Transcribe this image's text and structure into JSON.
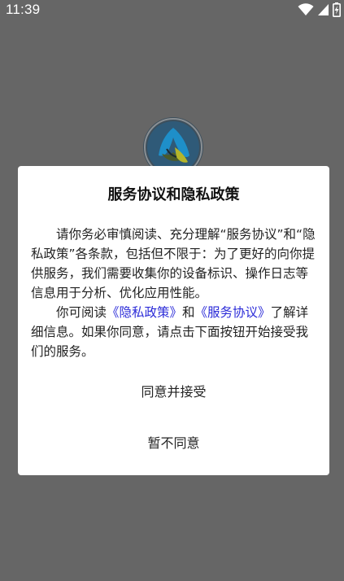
{
  "status_bar": {
    "time": "11:39",
    "icons": [
      "wifi-icon",
      "cell-signal-icon",
      "battery-charging-icon"
    ]
  },
  "app_logo": {
    "icon": "app-logo-icon"
  },
  "dialog": {
    "title": "服务协议和隐私政策",
    "paragraph1": "请你务必审慎阅读、充分理解“服务协议”和“隐私政策”各条款，包括但不限于：为了更好的向你提供服务，我们需要收集你的设备标识、操作日志等信息用于分析、优化应用性能。",
    "paragraph2_prefix": "你可阅读",
    "privacy_link": "《隐私政策》",
    "and_text": "和",
    "agreement_link": "《服务协议》",
    "paragraph2_suffix": "了解详细信息。如果你同意，请点击下面按钮开始接受我们的服务。",
    "agree_button": "同意并接受",
    "disagree_button": "暂不同意"
  },
  "colors": {
    "overlay": "#666666",
    "dialog_bg": "#ffffff",
    "link": "#2b2bd8",
    "text": "#222222"
  }
}
